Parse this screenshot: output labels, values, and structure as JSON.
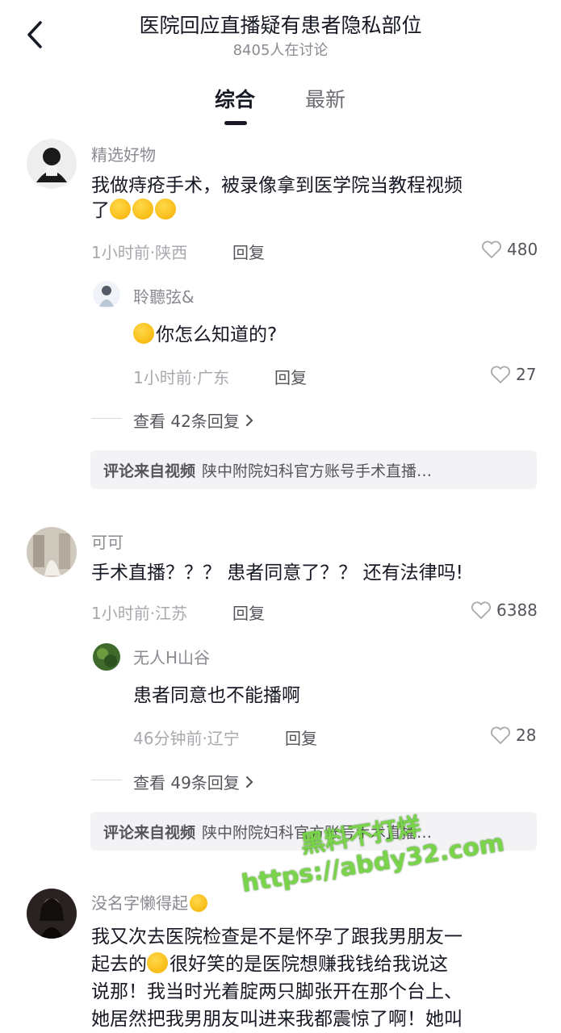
{
  "header": {
    "title": "医院回应直播疑有患者隐私部位",
    "subtitle": "8405人在讨论"
  },
  "tabs": [
    {
      "label": "综合",
      "active": true
    },
    {
      "label": "最新",
      "active": false
    }
  ],
  "comments": [
    {
      "username": "精选好物",
      "text": "我做痔疮手术，被录像拿到医学院当教程视频",
      "text_line2": "了",
      "meta": "1小时前·陕西",
      "reply_label": "回复",
      "likes": "480",
      "sub_reply": {
        "username": "聆聽弦&",
        "text": "你怎么知道的?",
        "meta": "1小时前·广东",
        "reply_label": "回复",
        "likes": "27"
      },
      "expand": "查看 42条回复",
      "source_label": "评论来自视频",
      "source_text": "陕中附院妇科官方账号手术直播…"
    },
    {
      "username": "可可",
      "text": "手术直播？？？ 患者同意了？？ 还有法律吗!",
      "meta": "1小时前·江苏",
      "reply_label": "回复",
      "likes": "6388",
      "sub_reply": {
        "username": "无人H山谷",
        "text": "患者同意也不能播啊",
        "meta": "46分钟前·辽宁",
        "reply_label": "回复",
        "likes": "28"
      },
      "expand": "查看 49条回复",
      "source_label": "评论来自视频",
      "source_text": "陕中附院妇科官方账号手术直播…"
    },
    {
      "username": "没名字懒得起",
      "lines": [
        "我又次去医院检查是不是怀孕了跟我男朋友一",
        "很好笑的是医院想赚我钱给我说这",
        "说那！我当时光着腚两只脚张开在那个台上、",
        "她居然把我男朋友叫进来我都震惊了啊！她叫"
      ],
      "line2_prefix": "起去的"
    }
  ],
  "watermark": {
    "line1": "黑料不打烊",
    "line2": "https://abdy32.com"
  }
}
